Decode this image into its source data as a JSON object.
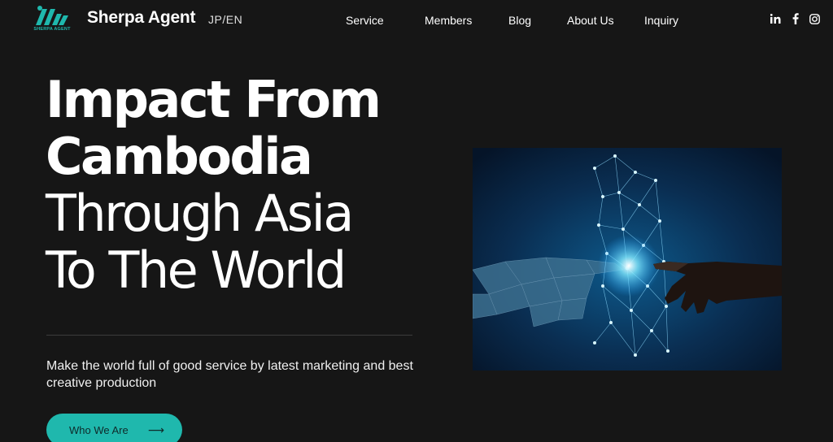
{
  "brand": {
    "name": "Sherpa Agent",
    "logo_text": "SHERPA AGENT",
    "lang_switch": "JP/EN"
  },
  "nav": [
    {
      "label": "Service"
    },
    {
      "label": "Members"
    },
    {
      "label": "Blog"
    },
    {
      "label": "About Us"
    },
    {
      "label": "Inquiry"
    }
  ],
  "social": [
    "linkedin-icon",
    "facebook-icon",
    "instagram-icon"
  ],
  "hero": {
    "title_lines": [
      "Impact From",
      "Cambodia",
      "Through Asia",
      "To The World"
    ],
    "tagline": "Make the world full of good service by latest marketing and best creative production",
    "cta_label": "Who We Are",
    "cta_arrow": "⟶"
  },
  "colors": {
    "accent": "#1fb8ad",
    "background": "#161616",
    "text": "#ffffff"
  }
}
